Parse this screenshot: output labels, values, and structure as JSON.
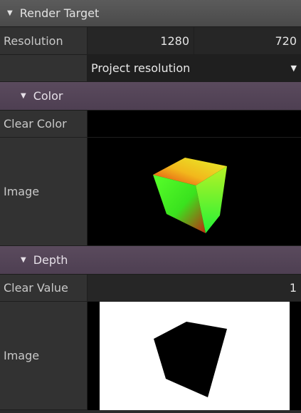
{
  "render_target": {
    "title": "Render Target",
    "resolution_label": "Resolution",
    "width": "1280",
    "height": "720",
    "resolution_mode": "Project resolution"
  },
  "color": {
    "title": "Color",
    "clear_label": "Clear Color",
    "clear_color": "#000000",
    "image_label": "Image"
  },
  "depth": {
    "title": "Depth",
    "clear_label": "Clear Value",
    "clear_value": "1",
    "image_label": "Image"
  },
  "icons": {
    "collapse": "triangle-down-icon",
    "dropdown": "dropdown-arrow-icon"
  },
  "colors": {
    "section_header": "#4e3f52",
    "top_header": "#505050",
    "background": "#2b2b2b"
  }
}
